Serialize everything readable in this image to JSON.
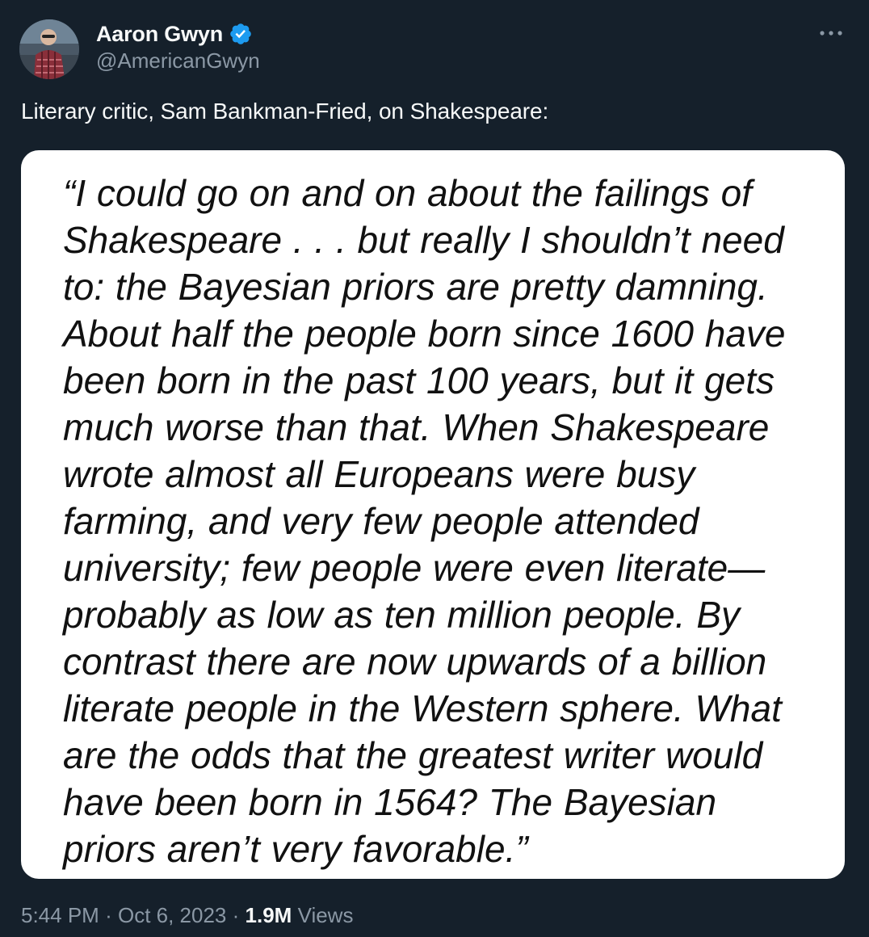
{
  "author": {
    "display_name": "Aaron Gwyn",
    "handle": "@AmericanGwyn",
    "verified": true,
    "avatar_icon": "profile-photo"
  },
  "tweet": {
    "text": "Literary critic, Sam Bankman-Fried, on Shakespeare:",
    "more_icon": "more-options-icon"
  },
  "quote_image": {
    "lines": [
      "“I could go on and on about the failings of",
      "Shakespeare . . . but really I shouldn’t need",
      "to: the Bayesian priors are pretty damning.",
      "About half the people born since 1600 have",
      "been born in the past 100 years, but it gets",
      "much worse than that. When Shakespeare",
      "wrote almost all Europeans were busy",
      "farming, and very few people attended",
      "university; few people were even literate—",
      "probably as low as ten million people. By",
      "contrast there are now upwards of a billion",
      "literate people in the Western sphere. What",
      "are the odds that the greatest writer would",
      "have been born in 1564? The Bayesian",
      "priors aren’t very favorable.”"
    ]
  },
  "meta": {
    "time": "5:44 PM",
    "separator": "·",
    "date": "Oct 6, 2023",
    "views_count": "1.9M",
    "views_label": "Views"
  },
  "colors": {
    "background": "#15202b",
    "text_primary": "#f7f9f9",
    "text_secondary": "#8b98a5",
    "verified_blue": "#1d9bf0"
  }
}
